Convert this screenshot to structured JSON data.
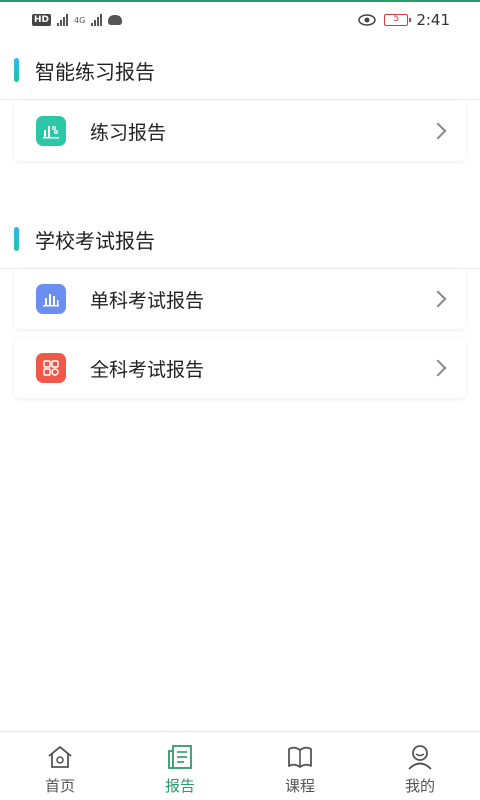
{
  "status_bar": {
    "network_badge": "HD",
    "network_type": "4G",
    "battery_level": "5",
    "time": "2:41"
  },
  "sections": [
    {
      "title": "智能练习报告",
      "items": [
        {
          "label": "练习报告",
          "icon": "practice-report-icon",
          "color": "#2cc7a6"
        }
      ]
    },
    {
      "title": "学校考试报告",
      "items": [
        {
          "label": "单科考试报告",
          "icon": "bar-chart-icon",
          "color": "#6b8ef2"
        },
        {
          "label": "全科考试报告",
          "icon": "grid-icon",
          "color": "#f1584a"
        }
      ]
    }
  ],
  "bottom_nav": {
    "active_index": 1,
    "items": [
      {
        "label": "首页",
        "icon": "home-icon"
      },
      {
        "label": "报告",
        "icon": "report-icon"
      },
      {
        "label": "课程",
        "icon": "book-icon"
      },
      {
        "label": "我的",
        "icon": "user-icon"
      }
    ]
  },
  "colors": {
    "accent": "#2e9a6a",
    "section_bar_top": "#2fb7f2",
    "section_bar_bottom": "#23c4a0"
  }
}
